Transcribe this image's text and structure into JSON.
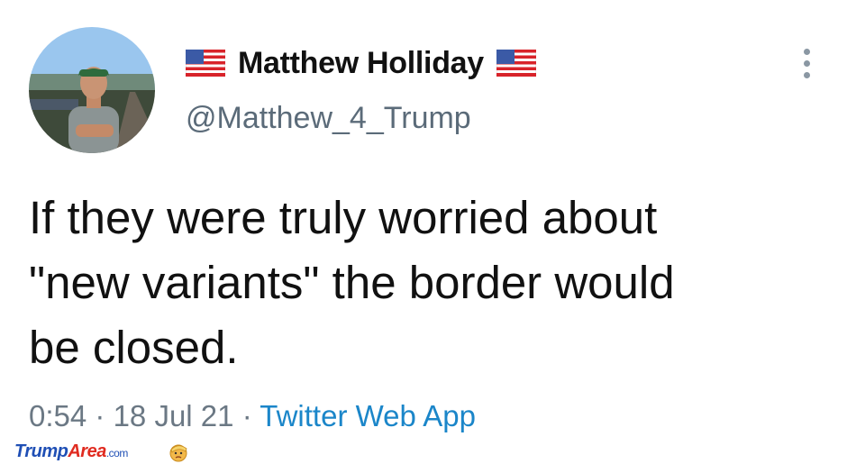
{
  "tweet": {
    "display_name": "Matthew Holliday",
    "handle": "@Matthew_4_Trump",
    "text": "If they were truly worried about\n\"new variants\" the border would\nbe closed.",
    "time": "0:54",
    "separator1": "·",
    "date": "18 Jul 21",
    "separator2": "·",
    "source": "Twitter Web App"
  },
  "icons": {
    "name_left": "us-flag-icon",
    "name_right": "us-flag-icon",
    "menu": "more-vertical-icon"
  },
  "footer": {
    "brand_part1": "Trump",
    "brand_part2": "Area",
    "brand_suffix": ".com"
  },
  "colors": {
    "text": "#111111",
    "handle": "#5b6b79",
    "meta": "#6b7884",
    "link": "#1b86c9",
    "brand_blue": "#1f4fb5",
    "brand_red": "#e02b20"
  }
}
